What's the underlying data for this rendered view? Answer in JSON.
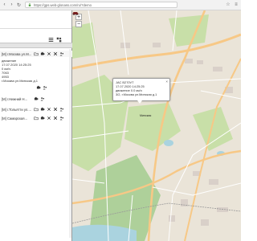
{
  "browser": {
    "url": "https://gps.web-glonass.com/ru/?demo"
  },
  "panel": {
    "rows": [
      {
        "label": "[M] г.Москва ул.М..."
      },
      {
        "label": "[M] г.Нижний Н..."
      },
      {
        "label": "[M] г.Тольятти ул...."
      },
      {
        "label": "[M] Самарская..."
      }
    ],
    "details": [
      "движение",
      "17.07.2020 14:25:25",
      "0 км/ч",
      "7063",
      "4953",
      "г.Москва ул.Минская д.1"
    ]
  },
  "map": {
    "popup": {
      "lines": [
        "JAC B270VT",
        "17.07.2020 14:25:25",
        "движение 0.0 км/ч",
        "3/2, г.Москва ул.Минская д.1"
      ],
      "close": "×"
    },
    "marker_label": "Минская",
    "zoom_in": "+",
    "zoom_out": "−"
  },
  "colors": {
    "map_base": "#eae4d8",
    "park": "#c8dfa8",
    "forest": "#aed09a",
    "water": "#aad3df",
    "road_major": "#f7c886",
    "road_minor": "#ffffff",
    "building": "#d9d0c9"
  }
}
